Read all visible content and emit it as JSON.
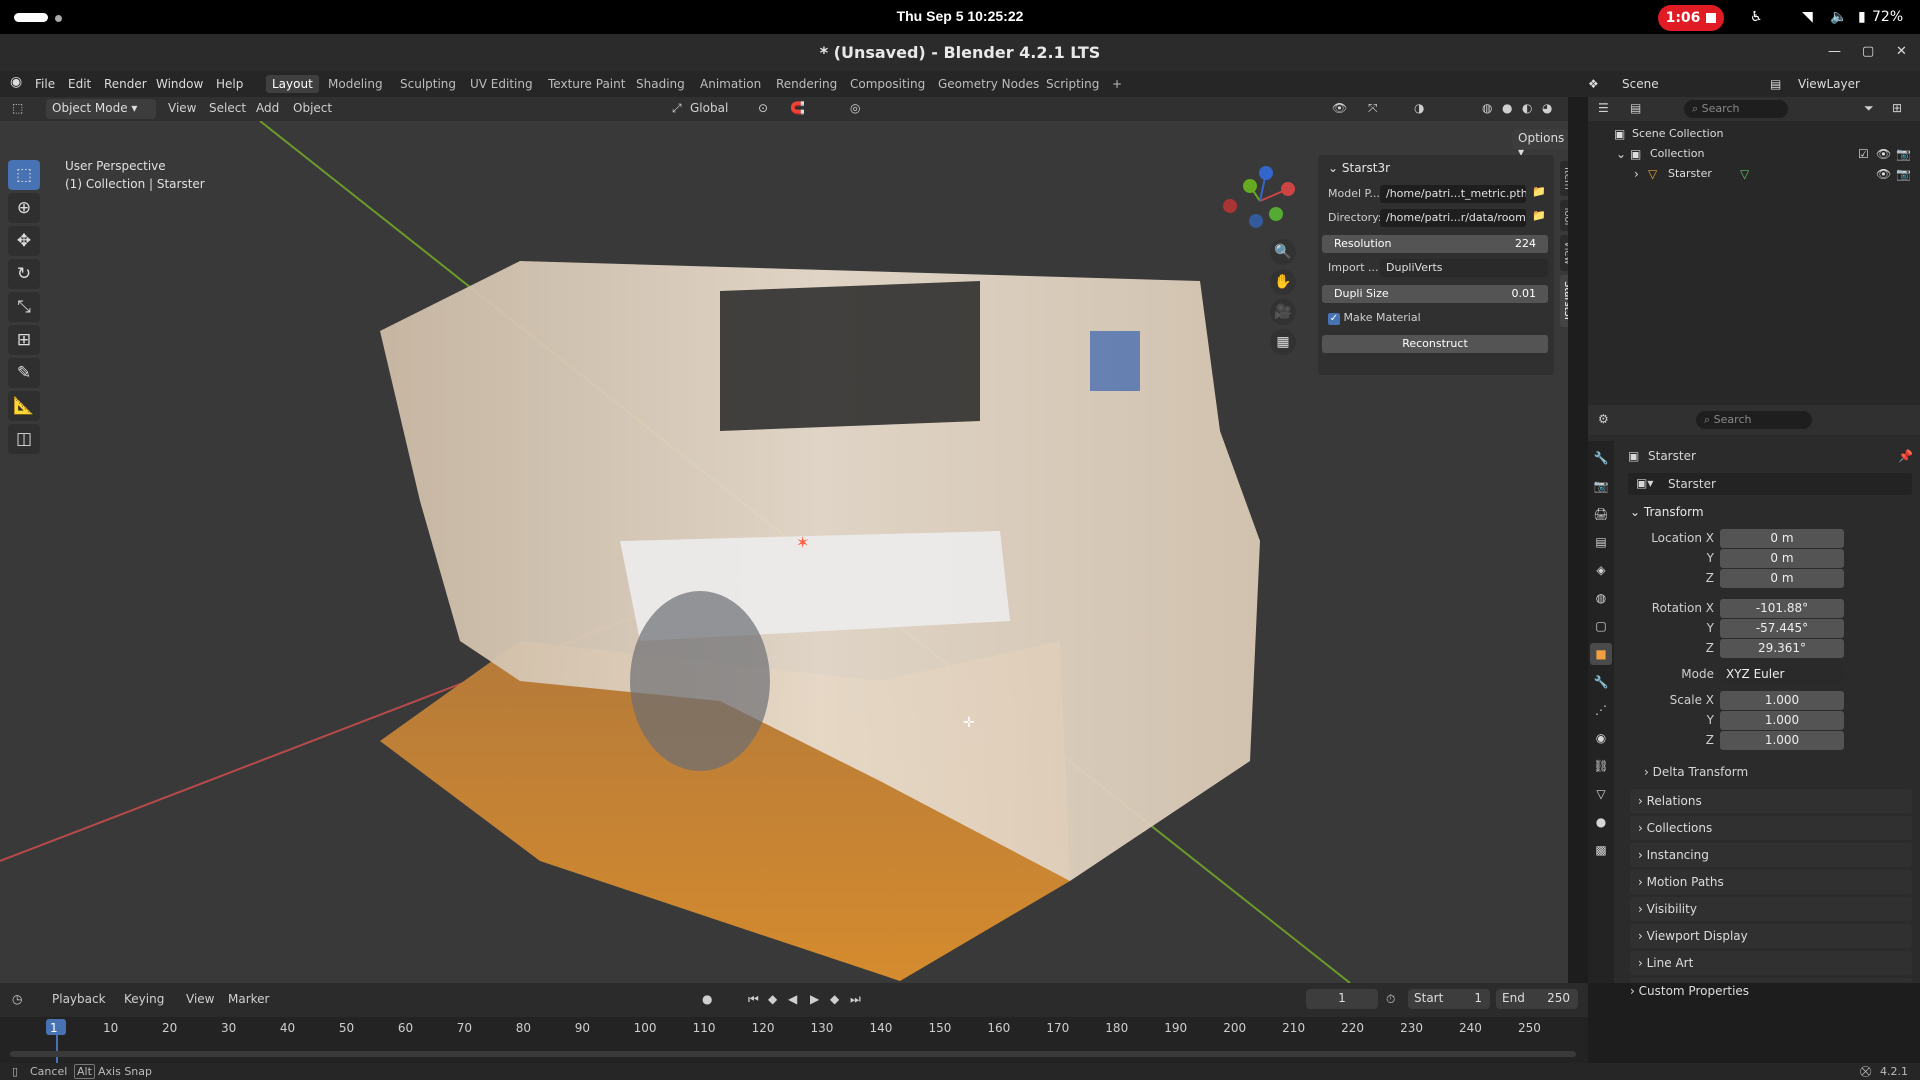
{
  "system_bar": {
    "clock": "Thu Sep 5  10:25:22",
    "recording_time": "1:06",
    "battery": "72%"
  },
  "window": {
    "title": "* (Unsaved) - Blender 4.2.1 LTS"
  },
  "menu": {
    "items": [
      "File",
      "Edit",
      "Render",
      "Window",
      "Help"
    ],
    "workspaces": [
      "Layout",
      "Modeling",
      "Sculpting",
      "UV Editing",
      "Texture Paint",
      "Shading",
      "Animation",
      "Rendering",
      "Compositing",
      "Geometry Nodes",
      "Scripting"
    ],
    "active_workspace": "Layout",
    "scene_label": "Scene",
    "view_layer_label": "ViewLayer"
  },
  "viewport_header": {
    "mode": "Object Mode",
    "menus": [
      "View",
      "Select",
      "Add",
      "Object"
    ],
    "orientation": "Global",
    "options": "Options"
  },
  "viewport": {
    "perspective": "User Perspective",
    "collection_info": "(1) Collection | Starster"
  },
  "npanel": {
    "title": "Starst3r",
    "model_label": "Model P...",
    "model_value": "/home/patri...t_metric.pth",
    "directory_label": "Directory:",
    "directory_value": "/home/patri...r/data/room/",
    "resolution_label": "Resolution",
    "resolution_value": "224",
    "import_label": "Import ...",
    "import_value": "DupliVerts",
    "dupli_label": "Dupli Size",
    "dupli_value": "0.01",
    "make_material": "Make Material",
    "reconstruct": "Reconstruct",
    "tabs": [
      "Item",
      "Tool",
      "View",
      "Starst3r"
    ]
  },
  "outliner": {
    "search_placeholder": "Search",
    "scene_collection": "Scene Collection",
    "collection": "Collection",
    "object": "Starster"
  },
  "properties": {
    "search_placeholder": "Search",
    "object_name": "Starster",
    "datablock_name": "Starster",
    "transform_label": "Transform",
    "location": {
      "label_x": "Location X",
      "label_y": "Y",
      "label_z": "Z",
      "x": "0 m",
      "y": "0 m",
      "z": "0 m"
    },
    "rotation": {
      "label_x": "Rotation X",
      "label_y": "Y",
      "label_z": "Z",
      "x": "-101.88°",
      "y": "-57.445°",
      "z": "29.361°"
    },
    "mode_label": "Mode",
    "mode_value": "XYZ Euler",
    "scale": {
      "label_x": "Scale X",
      "label_y": "Y",
      "label_z": "Z",
      "x": "1.000",
      "y": "1.000",
      "z": "1.000"
    },
    "delta_transform": "Delta Transform",
    "panels": [
      "Relations",
      "Collections",
      "Instancing",
      "Motion Paths",
      "Visibility",
      "Viewport Display",
      "Line Art",
      "Custom Properties"
    ]
  },
  "timeline": {
    "menus": [
      "Playback",
      "Keying",
      "View",
      "Marker"
    ],
    "current_frame": "1",
    "start_label": "Start",
    "start_value": "1",
    "end_label": "End",
    "end_value": "250",
    "ticks": [
      "1",
      "10",
      "20",
      "30",
      "40",
      "50",
      "60",
      "70",
      "80",
      "90",
      "100",
      "110",
      "120",
      "130",
      "140",
      "150",
      "160",
      "170",
      "180",
      "190",
      "200",
      "210",
      "220",
      "230",
      "240",
      "250"
    ]
  },
  "statusbar": {
    "cancel": "Cancel",
    "alt_key": "Alt",
    "axis_snap": "Axis Snap",
    "version": "4.2.1"
  },
  "colors": {
    "accent": "#4772b3",
    "record": "#e01b24"
  }
}
